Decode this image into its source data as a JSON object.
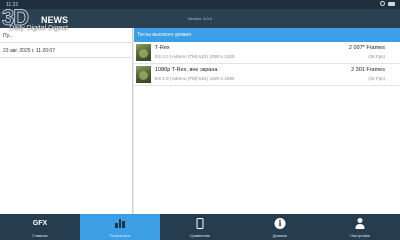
{
  "status_bar": {
    "time": "11:22"
  },
  "app_bar": {
    "version": "Version: 5.0.0"
  },
  "watermark": {
    "brand": "3D",
    "news": "NEWS",
    "subtitle": "Daily Digital Digest"
  },
  "left_panel": {
    "header": "Пу...",
    "rows": [
      {
        "date": "23 авг. 2025 г. 11:20:07"
      }
    ]
  },
  "right_panel": {
    "header": "Тесты высокого уровня",
    "results": [
      {
        "name": "T-Rex",
        "meta": "ES 2.0 | Adreno (TM) 610 | 2000 x 1200",
        "frames": "2 007* Frames",
        "fps": "(36 Fps)"
      },
      {
        "name": "1080p T-Rex, вне экрана",
        "meta": "ES 2.0 | Adreno (TM) 610 | 1920 x 1080",
        "frames": "2 301 Frames",
        "fps": "(41 Fps)"
      }
    ]
  },
  "bottom_nav": [
    {
      "label": "Главная",
      "icon": "gfx-icon",
      "icon_text": "GFX",
      "active": false
    },
    {
      "label": "Результаты",
      "icon": "bar-chart-icon",
      "active": true
    },
    {
      "label": "Сравнение",
      "icon": "phone-icon",
      "active": false
    },
    {
      "label": "Данные",
      "icon": "info-icon",
      "icon_text": "i",
      "active": false
    },
    {
      "label": "Настройки",
      "icon": "user-icon",
      "active": false
    }
  ],
  "colors": {
    "accent": "#3c9ee4",
    "nav_bg": "#263d4f",
    "app_bar": "#2b4152"
  }
}
